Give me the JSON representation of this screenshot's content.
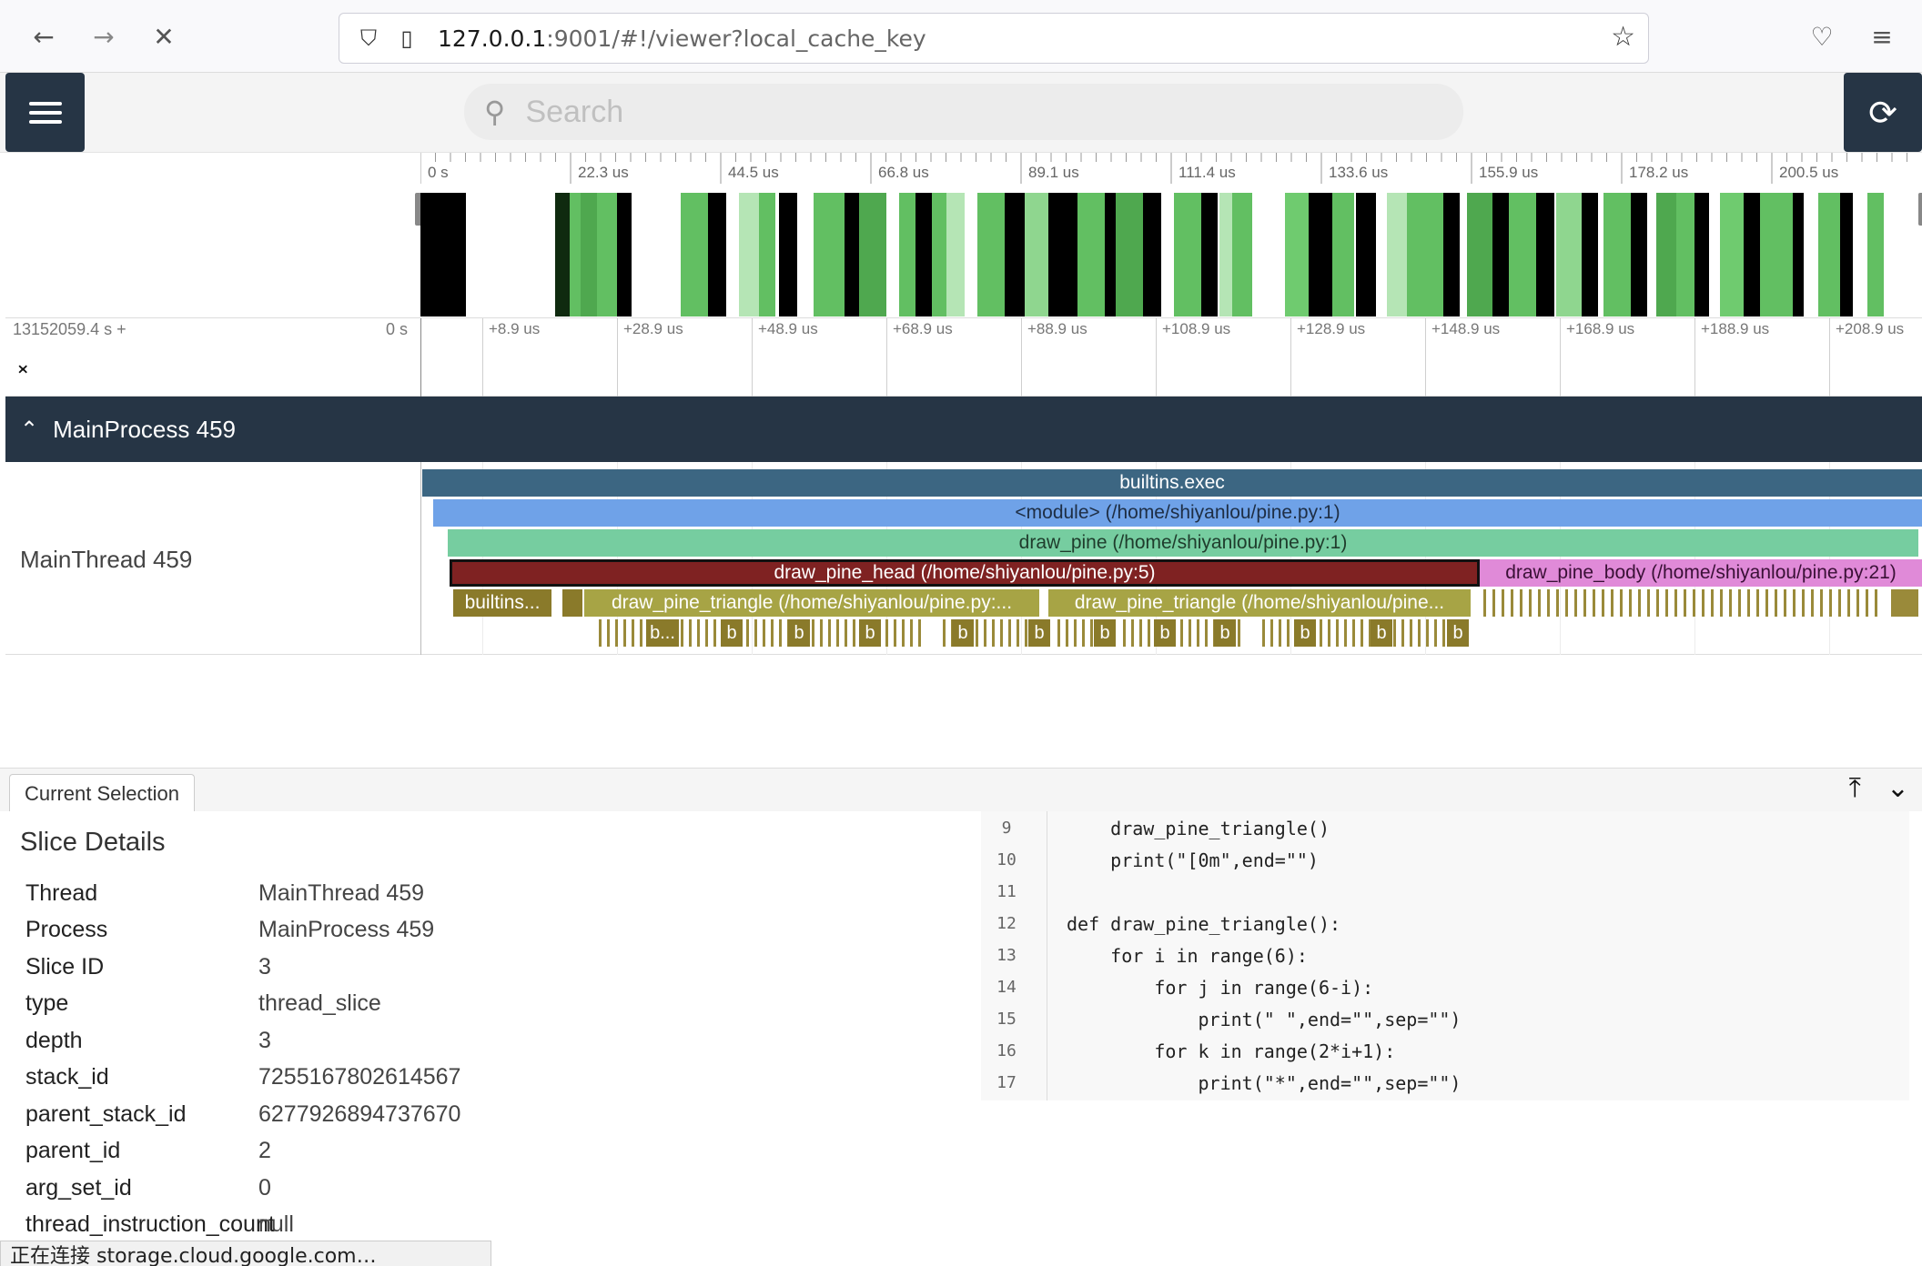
{
  "browser": {
    "url_host": "127.0.0.1",
    "url_rest": ":9001/#!/viewer?local_cache_key"
  },
  "search": {
    "placeholder": "Search"
  },
  "overview": {
    "tick_labels": [
      "0 s",
      "22.3 us",
      "44.5 us",
      "66.8 us",
      "89.1 us",
      "111.4 us",
      "133.6 us",
      "155.9 us",
      "178.2 us",
      "200.5 us"
    ]
  },
  "axis": {
    "left_label": "13152059.4 s +",
    "zero_label": "0 s",
    "tick_labels": [
      "+8.9 us",
      "+28.9 us",
      "+48.9 us",
      "+68.9 us",
      "+88.9 us",
      "+108.9 us",
      "+128.9 us",
      "+148.9 us",
      "+168.9 us",
      "+188.9 us",
      "+208.9 us"
    ]
  },
  "process": {
    "name": "MainProcess 459"
  },
  "thread": {
    "name": "MainThread 459",
    "slices": {
      "exec": "builtins.exec",
      "module": "<module> (/home/shiyanlou/pine.py:1)",
      "draw_pine": "draw_pine (/home/shiyanlou/pine.py:1)",
      "draw_pine_head": "draw_pine_head (/home/shiyanlou/pine.py:5)",
      "draw_pine_body": "draw_pine_body (/home/shiyanlou/pine.py:21)",
      "builtins_short": "builtins...",
      "triangle_1": "draw_pine_triangle (/home/shiyanlou/pine.py:...",
      "triangle_2": "draw_pine_triangle (/home/shiyanlou/pine...",
      "mini_b": "b",
      "mini_b_dots": "b..."
    },
    "colors": {
      "exec": "#3c6682",
      "module": "#6fa2e8",
      "draw_pine": "#76cda0",
      "draw_pine_head": "#7f2222",
      "draw_pine_body": "#e08ad8",
      "builtins": "#8a7a2a",
      "triangle": "#a7a445"
    }
  },
  "panel": {
    "tab_label": "Current Selection",
    "title": "Slice Details",
    "details": [
      {
        "key": "Thread",
        "value": "MainThread 459"
      },
      {
        "key": "Process",
        "value": "MainProcess 459"
      },
      {
        "key": "Slice ID",
        "value": "3"
      },
      {
        "key": "type",
        "value": "thread_slice"
      },
      {
        "key": "depth",
        "value": "3"
      },
      {
        "key": "stack_id",
        "value": "7255167802614567"
      },
      {
        "key": "parent_stack_id",
        "value": "6277926894737670"
      },
      {
        "key": "parent_id",
        "value": "2"
      },
      {
        "key": "arg_set_id",
        "value": "0"
      },
      {
        "key": "thread_instruction_count",
        "value": "null"
      }
    ]
  },
  "code": {
    "lines": [
      {
        "n": "9",
        "text": "    draw_pine_triangle()"
      },
      {
        "n": "10",
        "text": "    print(\"[0m\",end=\"\")"
      },
      {
        "n": "11",
        "text": ""
      },
      {
        "n": "12",
        "text": "def draw_pine_triangle():"
      },
      {
        "n": "13",
        "text": "    for i in range(6):"
      },
      {
        "n": "14",
        "text": "        for j in range(6-i):"
      },
      {
        "n": "15",
        "text": "            print(\" \",end=\"\",sep=\"\")"
      },
      {
        "n": "16",
        "text": "        for k in range(2*i+1):"
      },
      {
        "n": "17",
        "text": "            print(\"*\",end=\"\",sep=\"\")"
      }
    ]
  },
  "status": {
    "text": "正在连接 storage.cloud.google.com…"
  }
}
